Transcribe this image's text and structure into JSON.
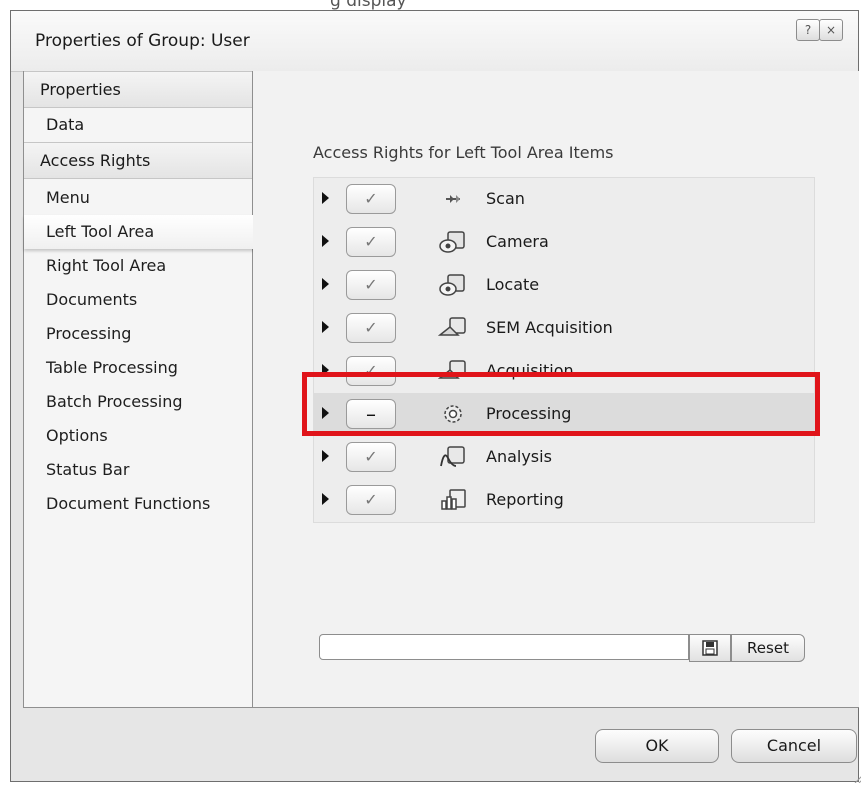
{
  "caption": "g display",
  "window": {
    "title": "Properties of Group: User",
    "help_label": "?",
    "close_label": "×"
  },
  "sidebar": {
    "sections": [
      {
        "header": "Properties",
        "items": [
          "Data"
        ]
      },
      {
        "header": "Access Rights",
        "items": [
          "Menu",
          "Left Tool Area",
          "Right Tool Area",
          "Documents",
          "Processing",
          "Table Processing",
          "Batch Processing",
          "Options",
          "Status Bar",
          "Document Functions"
        ]
      }
    ],
    "selected": "Left Tool Area"
  },
  "main": {
    "section_title": "Access Rights for Left Tool Area Items",
    "rows": [
      {
        "label": "Scan",
        "state": "✓",
        "icon": "scan-icon"
      },
      {
        "label": "Camera",
        "state": "✓",
        "icon": "camera-icon"
      },
      {
        "label": "Locate",
        "state": "✓",
        "icon": "locate-icon"
      },
      {
        "label": "SEM Acquisition",
        "state": "✓",
        "icon": "sem-acquisition-icon"
      },
      {
        "label": "Acquisition",
        "state": "✓",
        "icon": "acquisition-icon"
      },
      {
        "label": "Processing",
        "state": "–",
        "icon": "processing-icon"
      },
      {
        "label": "Analysis",
        "state": "✓",
        "icon": "analysis-icon"
      },
      {
        "label": "Reporting",
        "state": "✓",
        "icon": "reporting-icon"
      }
    ],
    "path_value": "",
    "reset_label": "Reset"
  },
  "footer": {
    "ok_label": "OK",
    "cancel_label": "Cancel"
  },
  "colors": {
    "annotation": "#e0141a"
  }
}
